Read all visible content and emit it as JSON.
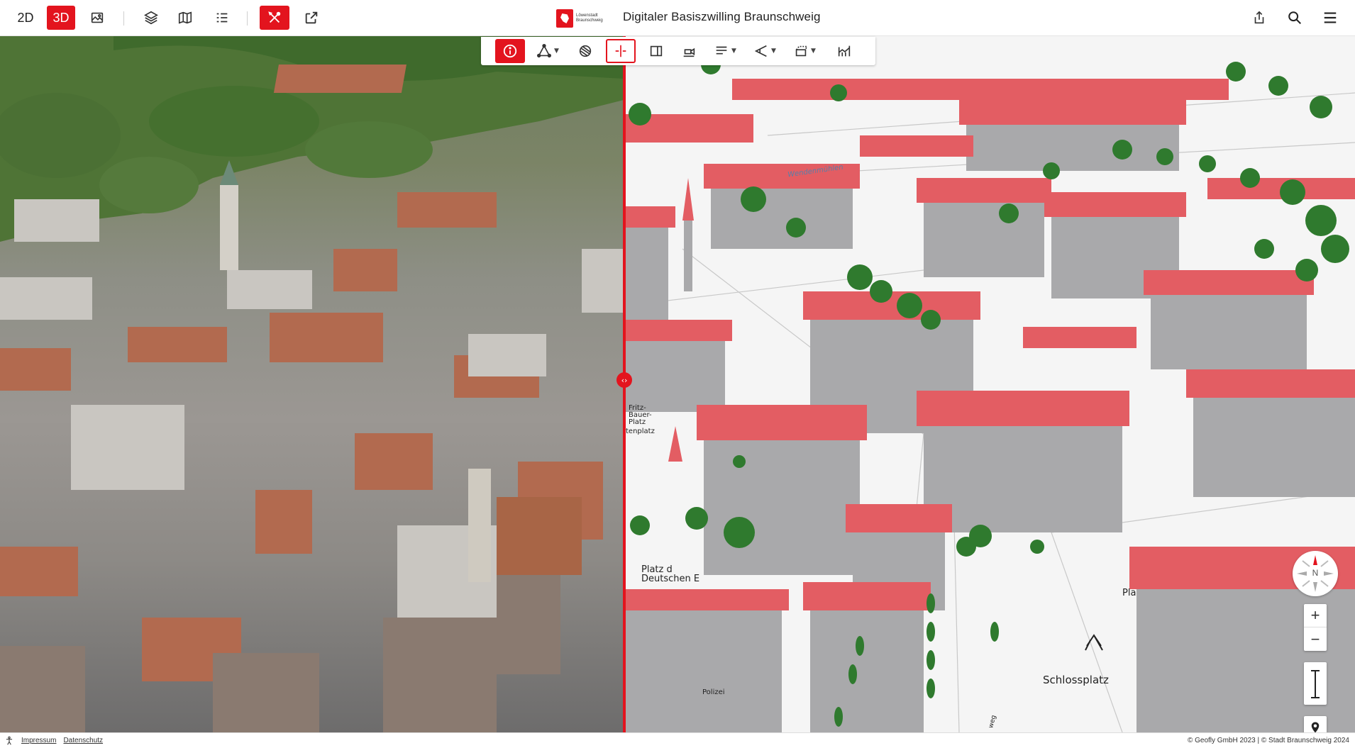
{
  "topbar": {
    "mode_2d": "2D",
    "mode_3d": "3D",
    "app_title": "Digitaler Basiszwilling Braunschweig",
    "brand_line1": "Löwenstadt",
    "brand_line2": "Braunschweig",
    "left_icons": [
      "image-icon",
      "layers-icon",
      "map-legend-icon",
      "list-icon",
      "tools-icon",
      "external-link-icon"
    ],
    "right_icons": [
      "share-icon",
      "search-icon",
      "menu-icon"
    ],
    "accent_color": "#e3141e"
  },
  "toolbar": {
    "tools": [
      {
        "icon": "info-icon",
        "active": true,
        "has_caret": false
      },
      {
        "icon": "draw-polygon-icon",
        "active": false,
        "has_caret": true
      },
      {
        "icon": "shadow-icon",
        "active": false,
        "has_caret": false
      },
      {
        "icon": "split-view-icon",
        "active": false,
        "outlined": true,
        "has_caret": false
      },
      {
        "icon": "sidebar-panel-icon",
        "active": false,
        "has_caret": false
      },
      {
        "icon": "viewpoint-icon",
        "active": false,
        "has_caret": false
      },
      {
        "icon": "section-2d-icon",
        "active": false,
        "has_caret": true
      },
      {
        "icon": "measure-angle-icon",
        "active": false,
        "has_caret": true
      },
      {
        "icon": "clipping-icon",
        "active": false,
        "has_caret": true
      },
      {
        "icon": "height-profile-icon",
        "active": false,
        "has_caret": false
      }
    ]
  },
  "map": {
    "split_handle": "‹›",
    "labels": {
      "wendenmuehlen": "Wendenmühlen",
      "fritz_bauer_platz": "Fritz-\nBauer-\nPlatz",
      "stechenplatz": "tenplatz",
      "platz_der_deutschen": "Platz d\nDeutschen E",
      "polizei": "Polizei",
      "schlossplatz": "Schlossplatz",
      "pla": "Pla",
      "weg": "weg"
    },
    "colors": {
      "roof": "#e35d63",
      "wall": "#a9a9ab",
      "tree": "#2f7a2e",
      "ground": "#f5f5f5"
    }
  },
  "controls": {
    "compass_label": "N",
    "zoom_in": "+",
    "zoom_out": "−"
  },
  "footer": {
    "impressum": "Impressum",
    "datenschutz": "Datenschutz",
    "copyright": "© Geofly GmbH 2023 | © Stadt Braunschweig 2024"
  }
}
